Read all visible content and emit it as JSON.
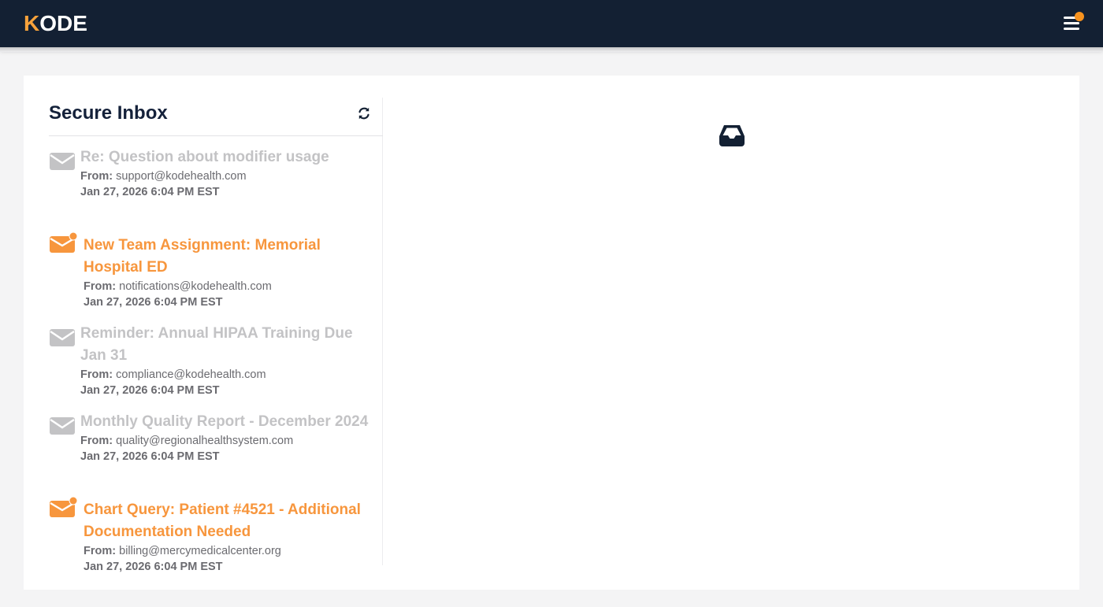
{
  "brand": {
    "logo_first": "K",
    "logo_rest": "ODE"
  },
  "inbox": {
    "title": "Secure Inbox",
    "messages": [
      {
        "subject": "Re: Question about modifier usage",
        "from_label": "From:",
        "from": "support@kodehealth.com",
        "date": "Jan 27, 2026 6:04 PM EST",
        "unread": false
      },
      {
        "subject": "New Team Assignment: Memorial Hospital ED",
        "from_label": "From:",
        "from": "notifications@kodehealth.com",
        "date": "Jan 27, 2026 6:04 PM EST",
        "unread": true
      },
      {
        "subject": "Reminder: Annual HIPAA Training Due Jan 31",
        "from_label": "From:",
        "from": "compliance@kodehealth.com",
        "date": "Jan 27, 2026 6:04 PM EST",
        "unread": false
      },
      {
        "subject": "Monthly Quality Report - December 2024",
        "from_label": "From:",
        "from": "quality@regionalhealthsystem.com",
        "date": "Jan 27, 2026 6:04 PM EST",
        "unread": false
      },
      {
        "subject": "Chart Query: Patient #4521 - Additional Documentation Needed",
        "from_label": "From:",
        "from": "billing@mercymedicalcenter.org",
        "date": "Jan 27, 2026 6:04 PM EST",
        "unread": true
      }
    ]
  },
  "icons": {
    "menu": "hamburger-menu-icon",
    "notification": "notification-dot",
    "refresh": "refresh-icon",
    "read_message": "envelope-icon",
    "unread_message": "envelope-unread-icon",
    "preview": "inbox-tray-icon"
  },
  "colors": {
    "navbar": "#132033",
    "accent": "#f7963d",
    "read_subject": "#c3c3c5",
    "text_dark": "#14213a"
  }
}
